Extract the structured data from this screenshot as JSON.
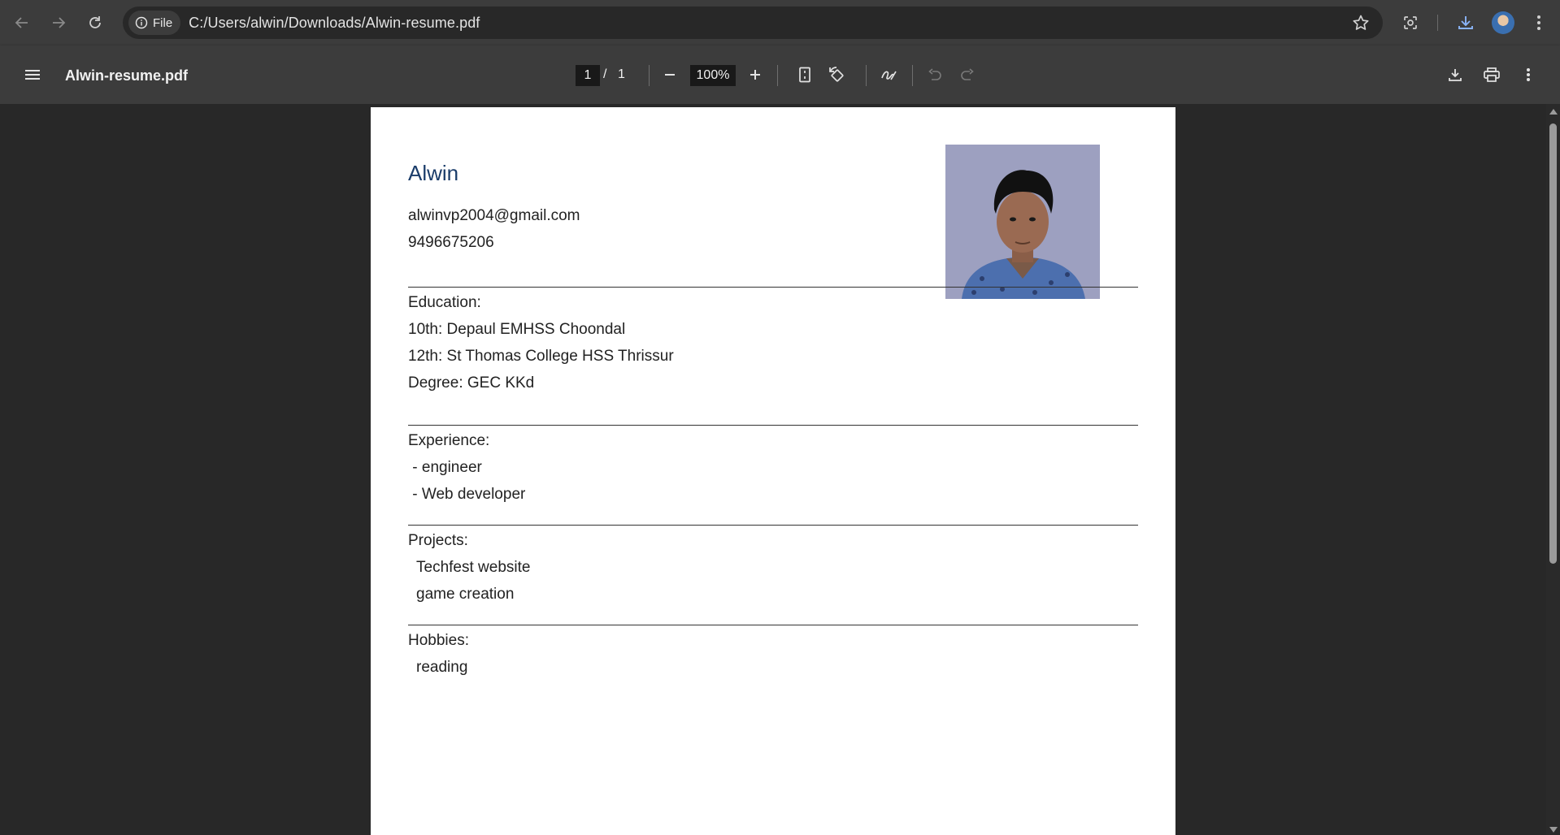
{
  "browser": {
    "site_chip_label": "File",
    "url": "C:/Users/alwin/Downloads/Alwin-resume.pdf"
  },
  "toolbar": {
    "doc_title": "Alwin-resume.pdf",
    "page_current": "1",
    "page_separator": "/",
    "page_total": "1",
    "zoom": "100%"
  },
  "resume": {
    "name": "Alwin",
    "email": "alwinvp2004@gmail.com",
    "phone": "9496675206",
    "education_heading": "Education:",
    "education": [
      "10th: Depaul EMHSS Choondal",
      "12th: St Thomas College HSS Thrissur",
      "Degree: GEC KKd"
    ],
    "experience_heading": "Experience:",
    "experience": [
      " - engineer",
      " - Web developer"
    ],
    "projects_heading": "Projects:",
    "projects": [
      "Techfest website",
      "game creation"
    ],
    "hobbies_heading": "Hobbies:",
    "hobbies": [
      "reading"
    ]
  },
  "colors": {
    "chrome_bg": "#3c3c3c",
    "viewer_bg": "#282828",
    "name_color": "#1a3c6a",
    "photo_bg": "#9da0c0"
  }
}
